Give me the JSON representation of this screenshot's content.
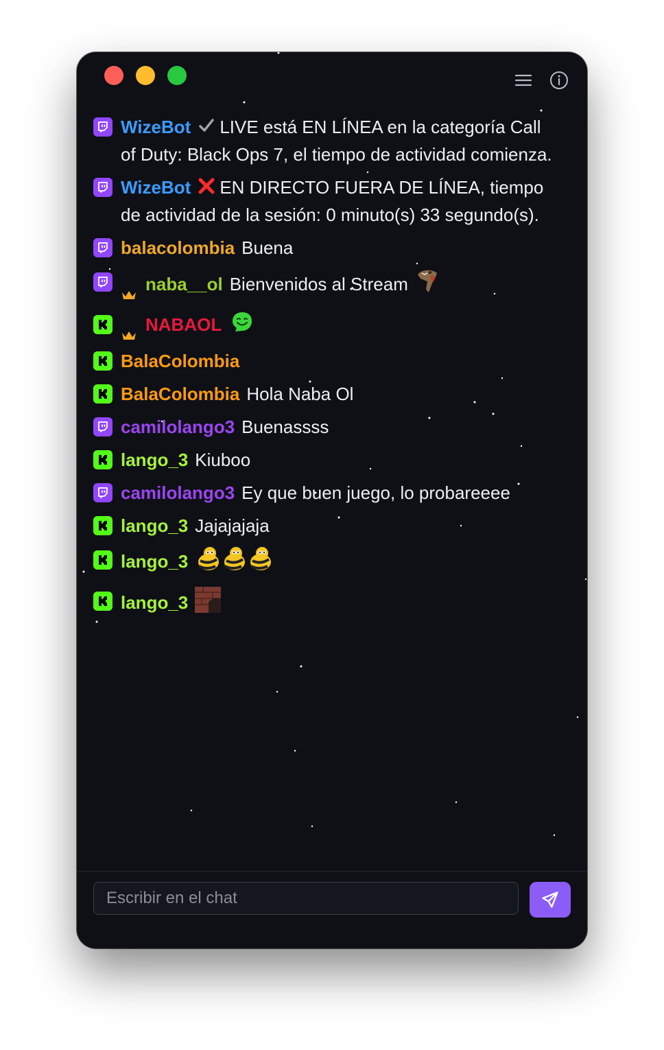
{
  "window": {
    "title": ""
  },
  "colors": {
    "twitch": "#9146ff",
    "kick": "#53fc18",
    "accent": "#8b5cf6"
  },
  "header": {
    "menu_icon": "hamburger-icon",
    "info_icon": "info-icon"
  },
  "messages": [
    {
      "platform": "twitch",
      "user": "WizeBot",
      "user_color": "#3b9cff",
      "badge": "check-icon",
      "text": "LIVE está EN LÍNEA en la categoría Call of Duty: Black Ops 7, el tiempo de actividad comienza."
    },
    {
      "platform": "twitch",
      "user": "WizeBot",
      "user_color": "#3b9cff",
      "badge": "cross-icon",
      "text": "EN DIRECTO FUERA DE LÍNEA, tiempo de actividad de la sesión: 0 minuto(s) 33 segundo(s)."
    },
    {
      "platform": "twitch",
      "user": "balacolombia",
      "user_color": "#f0a828",
      "text": "Buena"
    },
    {
      "platform": "twitch",
      "user": "naba__ol",
      "user_color": "#9ad02c",
      "crown": true,
      "text": "Bienvenidos al Stream",
      "emote": "dinosaur-emote"
    },
    {
      "platform": "kick",
      "user": "NABAOL",
      "user_color": "#e8193c",
      "crown": true,
      "text": "",
      "emote": "green-smile-emote"
    },
    {
      "platform": "kick",
      "user": "BalaColombia",
      "user_color": "#ff9a10",
      "text": ""
    },
    {
      "platform": "kick",
      "user": "BalaColombia",
      "user_color": "#ff9a10",
      "text": "Hola Naba Ol"
    },
    {
      "platform": "twitch",
      "user": "camilolango3",
      "user_color": "#9b45f0",
      "text": "Buenassss"
    },
    {
      "platform": "kick",
      "user": "lango_3",
      "user_color": "#a6f23c",
      "text": "Kiuboo"
    },
    {
      "platform": "twitch",
      "user": "camilolango3",
      "user_color": "#9b45f0",
      "text": "Ey que buen juego, lo probareeee"
    },
    {
      "platform": "kick",
      "user": "lango_3",
      "user_color": "#a6f23c",
      "text": "Jajajajaja"
    },
    {
      "platform": "kick",
      "user": "lango_3",
      "user_color": "#a6f23c",
      "text": "",
      "emote": "bee-emote-x3"
    },
    {
      "platform": "kick",
      "user": "lango_3",
      "user_color": "#a6f23c",
      "text": "",
      "emote": "brick-photo-emote"
    }
  ],
  "input": {
    "placeholder": "Escribir en el chat",
    "value": ""
  },
  "send_button": {
    "icon": "send-icon"
  }
}
